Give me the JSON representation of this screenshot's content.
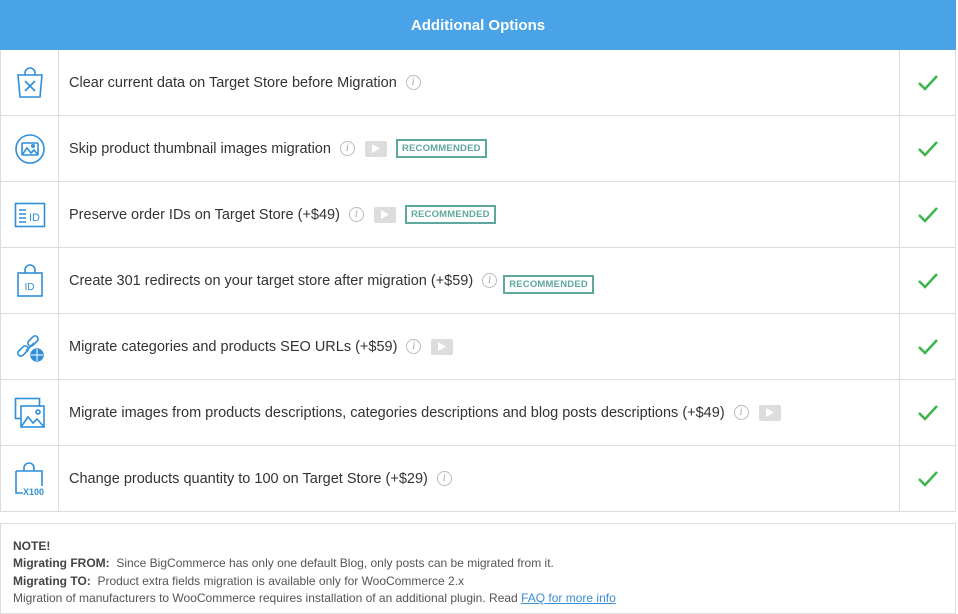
{
  "header": {
    "title": "Additional Options"
  },
  "rows": [
    {
      "label": "Clear current data on Target Store before Migration",
      "icon": "clear-data-icon"
    },
    {
      "label": "Skip product thumbnail images migration",
      "icon": "thumbnail-image-icon",
      "badge": "RECOMMENDED"
    },
    {
      "label": "Preserve order IDs on Target Store (+$49)",
      "icon": "order-id-icon",
      "badge": "RECOMMENDED"
    },
    {
      "label": "Create 301 redirects on your target store after migration (+$59)",
      "icon": "redirect-id-bag-icon",
      "badge": "RECOMMENDED"
    },
    {
      "label": "Migrate categories and products SEO URLs (+$59)",
      "icon": "seo-url-icon"
    },
    {
      "label": "Migrate images from products descriptions, categories descriptions and blog posts descriptions (+$49)",
      "icon": "description-images-icon"
    },
    {
      "label": "Change products quantity to 100 on Target Store (+$29)",
      "icon": "quantity-bag-icon"
    }
  ],
  "info_glyph": "i",
  "icon_text": {
    "id": "ID",
    "x100": "X100"
  },
  "colors": {
    "header_bg": "#4aa3e6",
    "icon": "#2f8fd8",
    "check": "#3cb54a",
    "badge": "#5fa89e"
  },
  "note": {
    "title": "NOTE!",
    "from_label": "Migrating FROM:",
    "from_text": "Since BigCommerce has only one default Blog, only posts can be migrated from it.",
    "to_label": "Migrating TO:",
    "to_text": "Product extra fields migration is available only for WooCommerce 2.x",
    "manufacturers_text": "Migration of manufacturers to WooCommerce requires installation of an additional plugin. Read",
    "faq_link": "FAQ for more info"
  }
}
